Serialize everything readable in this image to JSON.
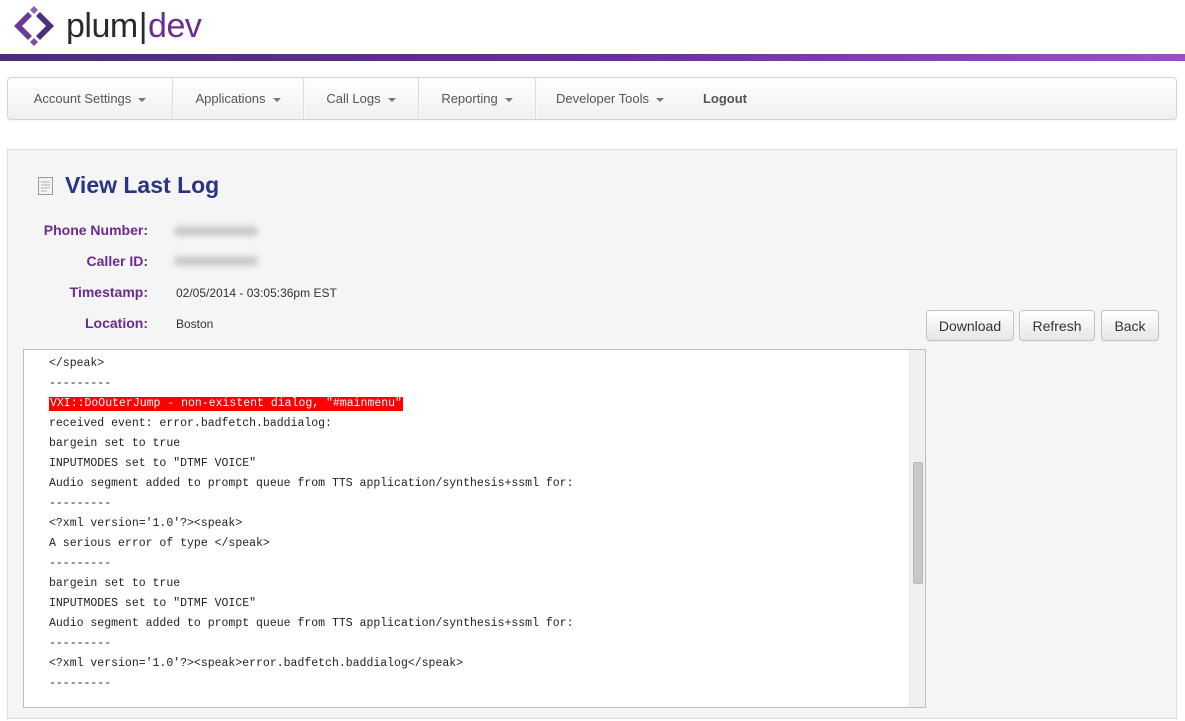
{
  "brand": {
    "name_part1": "plum",
    "separator": "|",
    "name_part2": "dev",
    "colors": {
      "plum": "#6d2b8f",
      "navy": "#2b3384",
      "accent": "#7a3aa8"
    }
  },
  "nav": {
    "items": [
      {
        "label": "Account Settings",
        "has_caret": true
      },
      {
        "label": "Applications",
        "has_caret": true
      },
      {
        "label": "Call Logs",
        "has_caret": true
      },
      {
        "label": "Reporting",
        "has_caret": true
      },
      {
        "label": "Developer Tools",
        "has_caret": true
      },
      {
        "label": "Logout",
        "has_caret": false
      }
    ]
  },
  "page": {
    "title": "View Last Log",
    "title_icon": "document-icon",
    "fields": {
      "phone_label": "Phone Number:",
      "caller_label": "Caller ID:",
      "timestamp_label": "Timestamp:",
      "timestamp_value": "02/05/2014 - 03:05:36pm EST",
      "location_label": "Location:",
      "location_value": "Boston"
    },
    "buttons": {
      "download": "Download",
      "refresh": "Refresh",
      "back": "Back"
    }
  },
  "log": {
    "lines": [
      "</speak>",
      "---------",
      "VXI::DoOuterJump - non-existent dialog, \"#mainmenu\"",
      "received event: error.badfetch.baddialog:",
      "bargein set to true",
      "INPUTMODES set to \"DTMF VOICE\"",
      "Audio segment added to prompt queue from TTS application/synthesis+ssml for:",
      "---------",
      "<?xml version='1.0'?><speak>",
      "A serious error of type </speak>",
      "---------",
      "bargein set to true",
      "INPUTMODES set to \"DTMF VOICE\"",
      "Audio segment added to prompt queue from TTS application/synthesis+ssml for:",
      "---------",
      "<?xml version='1.0'?><speak>error.badfetch.baddialog</speak>",
      "---------"
    ],
    "highlighted_line": 2
  }
}
